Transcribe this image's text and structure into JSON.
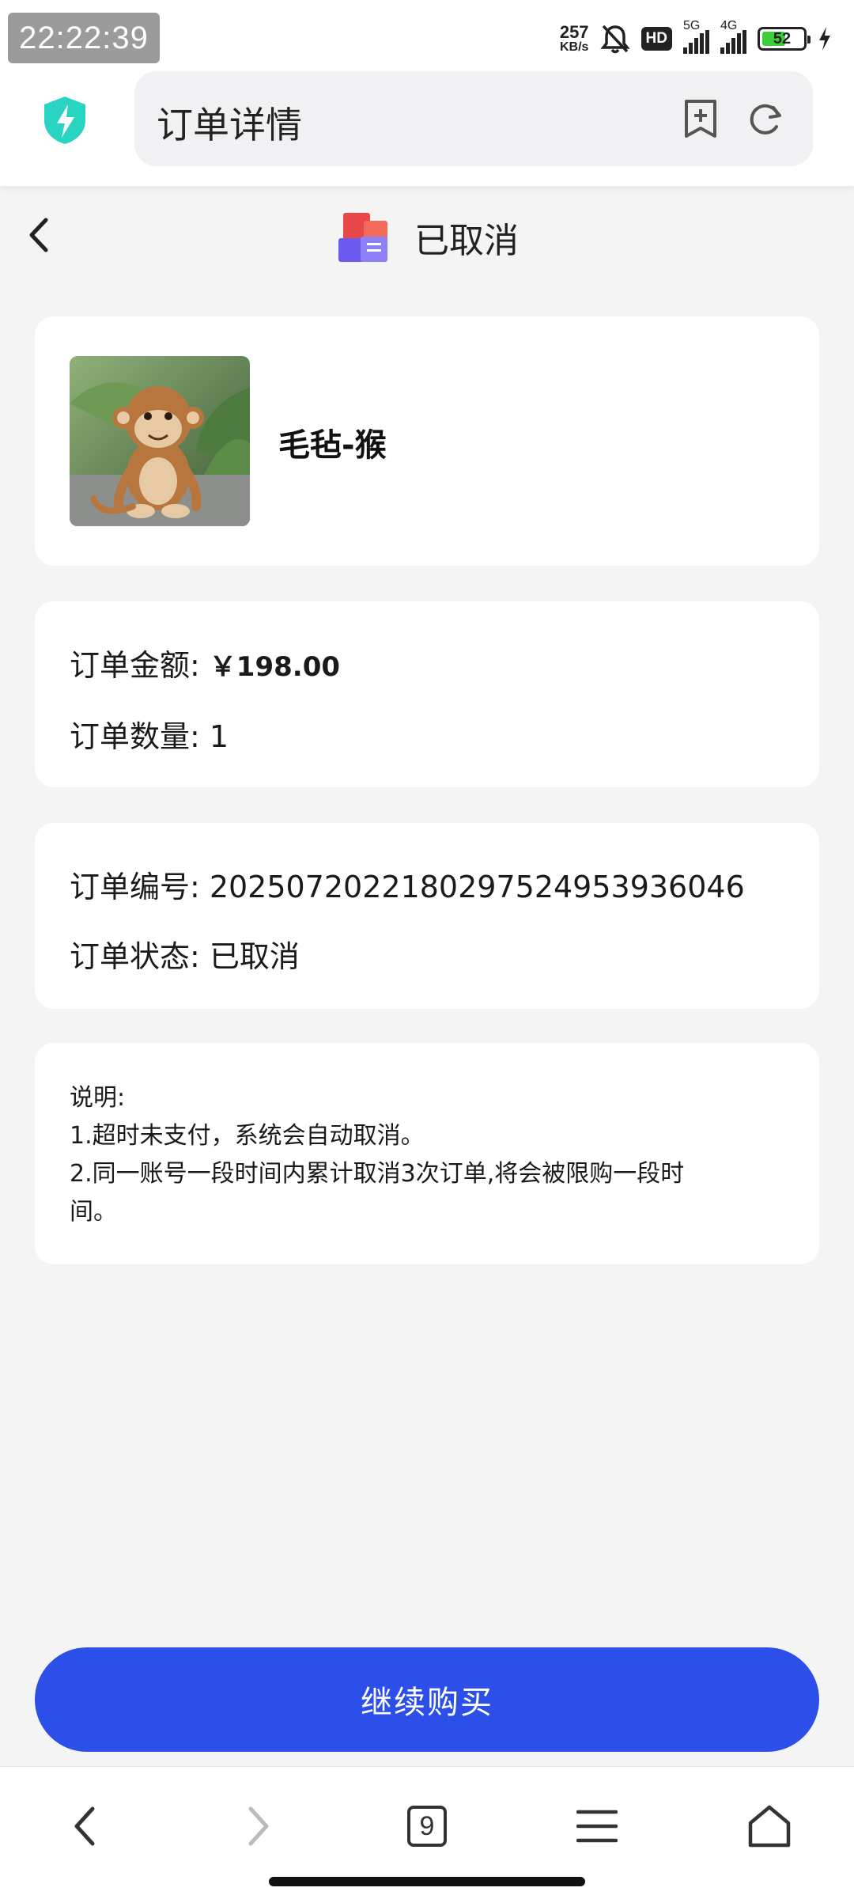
{
  "status_bar": {
    "time": "22:22:39",
    "net_speed_value": "257",
    "net_speed_unit": "KB/s",
    "hd_badge": "HD",
    "network_1": "5G",
    "network_2": "4G",
    "battery_level": "52"
  },
  "browser": {
    "page_title": "订单详情",
    "icons": [
      "shield-bolt-icon",
      "add-bookmark-icon",
      "refresh-icon"
    ]
  },
  "order_header": {
    "status_label": "已取消",
    "status_icon": "order-boxes-icon"
  },
  "product": {
    "name": "毛毡-猴",
    "image": "felt-monkey-toy-photo"
  },
  "amount": {
    "amount_label": "订单金额:",
    "amount_value": "￥198.00",
    "quantity_label": "订单数量:",
    "quantity_value": "1"
  },
  "order_info": {
    "number_label": "订单编号:",
    "number_value": "20250720221802975249539360​46",
    "status_label": "订单状态:",
    "status_value": "已取消"
  },
  "notes": {
    "title": "说明:",
    "line1": "1.超时未支付，系统会自动取消。",
    "line2a": "2.同一账号一段时间内累计取消3次订单,将会被限购一段时",
    "line2b": "间。"
  },
  "cta": {
    "label": "继续购买",
    "color": "#2b4fe8"
  },
  "bottom_nav": {
    "tab_count": "9",
    "icons": [
      "back-icon",
      "forward-icon",
      "tabs-icon",
      "menu-icon",
      "home-icon"
    ]
  }
}
